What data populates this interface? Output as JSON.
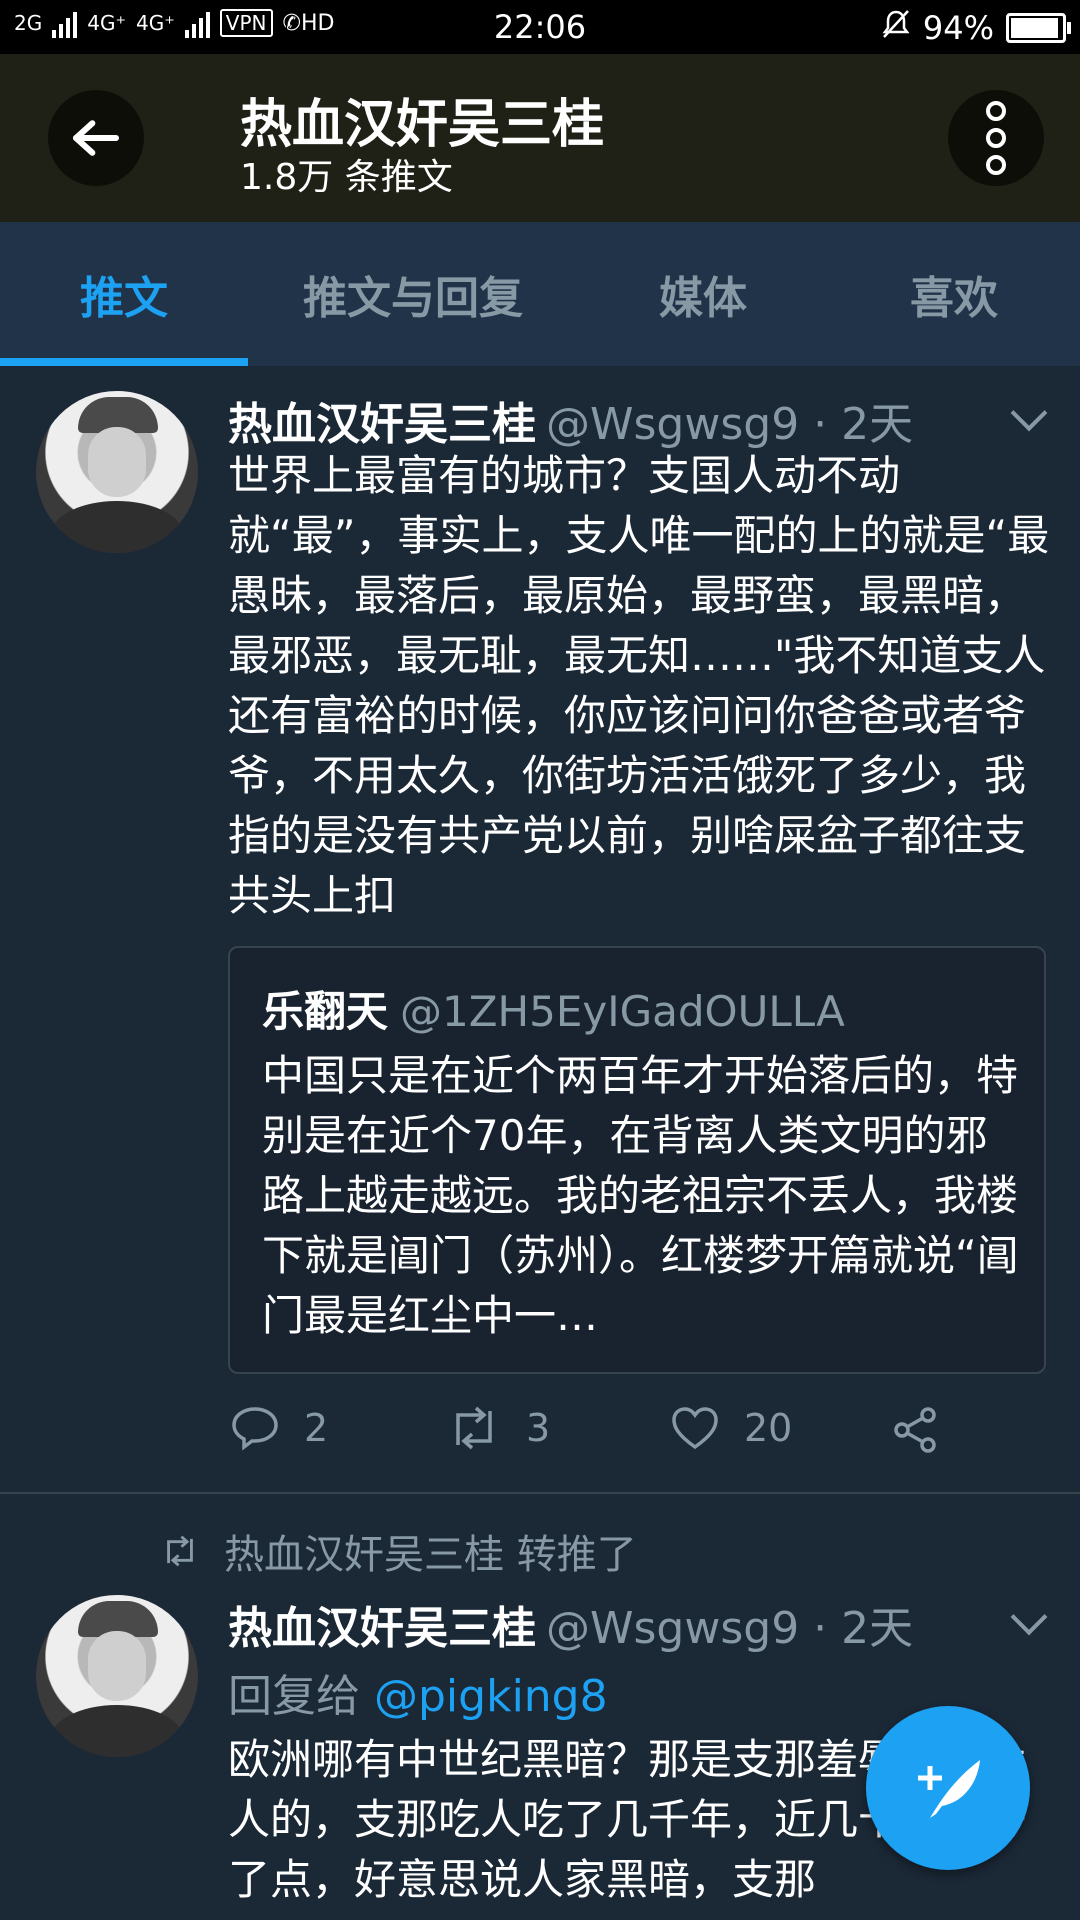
{
  "status_bar": {
    "network_1": "2G",
    "network_2": "4G⁺",
    "network_3": "4G⁺",
    "vpn": "VPN",
    "hd": "HD",
    "time": "22:06",
    "battery": "94%",
    "battery_level": 0.94
  },
  "header": {
    "title": "热血汉奸吴三桂",
    "subtitle": "1.8万 条推文"
  },
  "tabs": [
    {
      "label": "推文",
      "active": true
    },
    {
      "label": "推文与回复",
      "active": false
    },
    {
      "label": "媒体",
      "active": false
    },
    {
      "label": "喜欢",
      "active": false
    }
  ],
  "tweet1": {
    "name": "热血汉奸吴三桂",
    "handle": "@Wsgwsg9 · 2天",
    "text": "世界上最富有的城市？支国人动不动就“最”，事实上，支人唯一配的上的就是“最愚昧，最落后，最原始，最野蛮，最黑暗，最邪恶，最无耻，最无知……\"我不知道支人还有富裕的时候，你应该问问你爸爸或者爷爷，不用太久，你街坊活活饿死了多少，我指的是没有共产党以前，别啥屎盆子都往支共头上扣",
    "quote": {
      "name": "乐翻天",
      "handle": "@1ZH5EyIGadOULLA",
      "text": "中国只是在近个两百年才开始落后的，特别是在近个70年，在背离人类文明的邪路上越走越远。我的老祖宗不丢人，我楼下就是阊门（苏州）。红楼梦开篇就说“阊门最是红尘中一…"
    },
    "actions": {
      "replies": "2",
      "retweets": "3",
      "likes": "20"
    }
  },
  "tweet2": {
    "retweeted_by": "热血汉奸吴三桂 转推了",
    "name": "热血汉奸吴三桂",
    "handle": "@Wsgwsg9 · 2天",
    "reply_prefix": "回复给",
    "reply_mention": "@pigking8",
    "text": "欧洲哪有中世纪黑暗？那是支那羞辱黑洋大人的，支那吃人吃了几千年，近几十年才好了点，好意思说人家黑暗，支那"
  },
  "colors": {
    "background": "#1b2836",
    "accent": "#1da1f2",
    "secondary_text": "#8899a6"
  }
}
